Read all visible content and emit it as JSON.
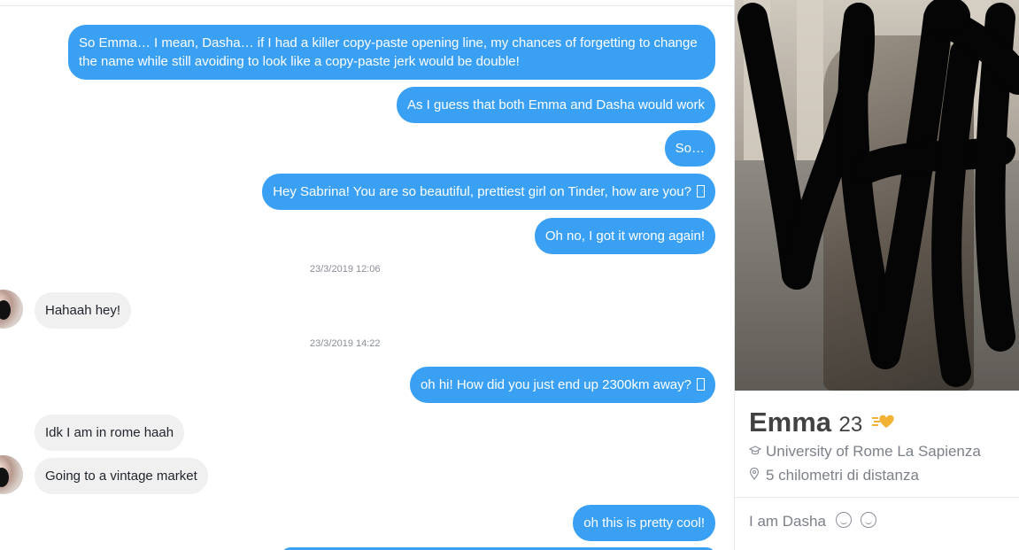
{
  "chat": {
    "messages": [
      {
        "text": "So Emma… I mean, Dasha… if I had a killer copy-paste opening line, my chances of forgetting to change the name while still avoiding to look like a copy-paste jerk would be double!"
      },
      {
        "text": "As I guess that both Emma and Dasha would work"
      },
      {
        "text": "So…"
      },
      {
        "text": "Hey Sabrina! You are so beautiful, prettiest girl on Tinder, how are you?"
      },
      {
        "text": "Oh no, I got it wrong again!"
      },
      {
        "text": "23/3/2019 12:06"
      },
      {
        "text": "Hahaah hey!"
      },
      {
        "text": "23/3/2019 14:22"
      },
      {
        "text": "oh hi! How did you just end up 2300km away?"
      },
      {
        "text": "Idk I am in rome haah"
      },
      {
        "text": "Going to a vintage market"
      },
      {
        "text": "oh this is pretty cool!"
      }
    ]
  },
  "profile": {
    "name": "Emma",
    "age": "23",
    "school": "University of Rome La Sapienza",
    "distance": "5 chilometri di distanza",
    "bio": "I am Dasha",
    "school_icon": "graduation-cap-icon",
    "distance_icon": "location-pin-icon",
    "superlike_icon": "super-like-icon",
    "accent": "#3aa0f3",
    "superlike_color": "#f2b233"
  }
}
